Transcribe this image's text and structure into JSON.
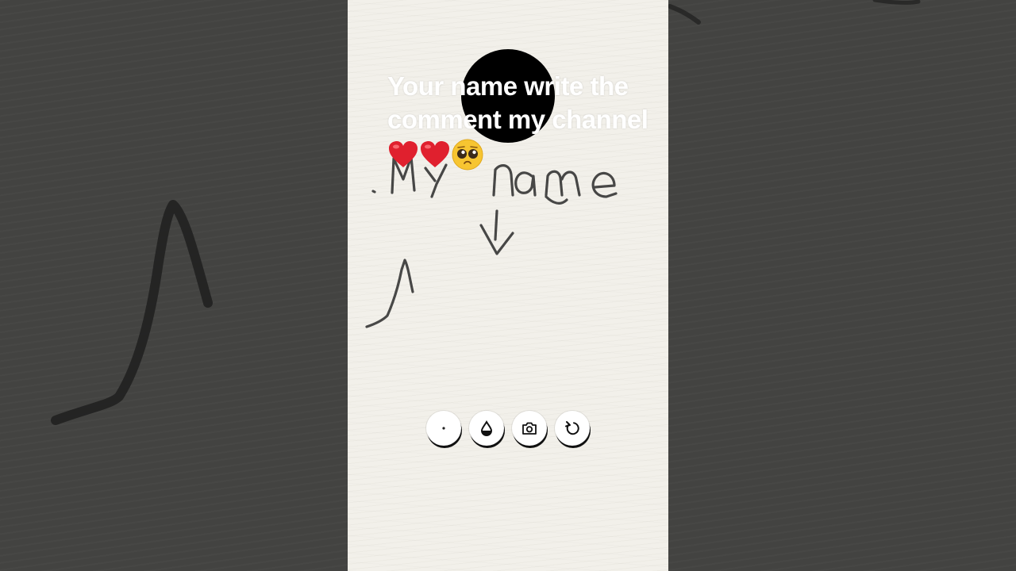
{
  "overlay": {
    "caption": "Your name write the comment my channel"
  },
  "drawing": {
    "handwritten_text": "My name"
  },
  "toolbar": {
    "buttons": [
      {
        "icon": "brush-size-icon"
      },
      {
        "icon": "ink-drop-icon"
      },
      {
        "icon": "camera-icon"
      },
      {
        "icon": "undo-icon"
      }
    ]
  },
  "colors": {
    "paper": "#f2f0ea",
    "side_background": "#434341",
    "ink": "#2a2a2a",
    "heart": "#e0202e",
    "button_bg": "#ffffff"
  }
}
